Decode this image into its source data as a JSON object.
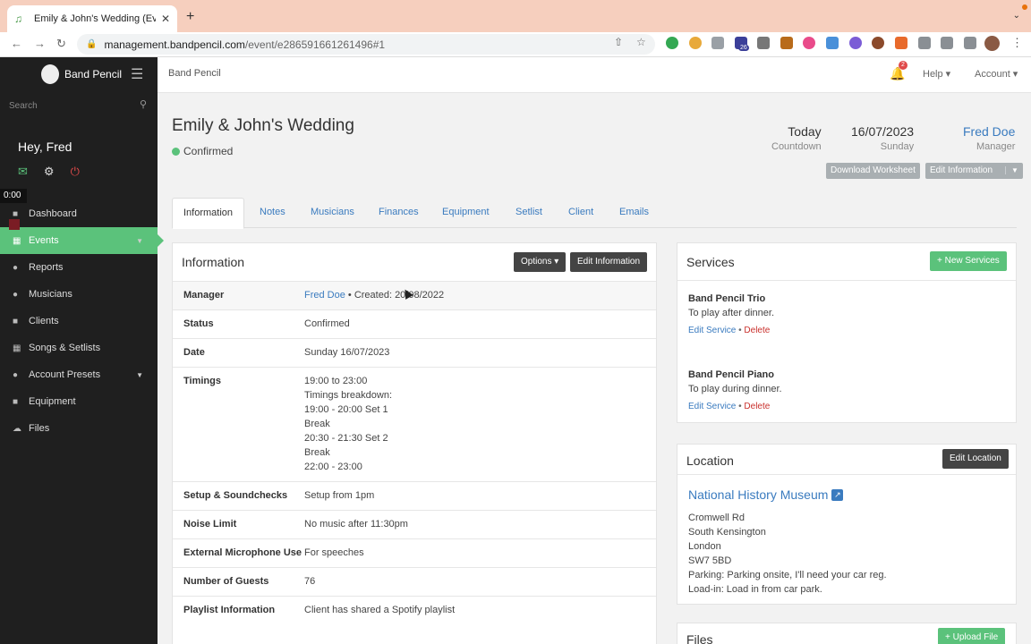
{
  "browser": {
    "tab_title": "Emily & John's Wedding (Event",
    "url_host": "management.bandpencil.com",
    "url_path": "/event/e286591661261496#1",
    "ext_badge": "26"
  },
  "sidebar": {
    "brand": "Band Pencil",
    "search_placeholder": "Search",
    "greeting": "Hey, Fred",
    "timer": "0:00",
    "items": [
      {
        "label": "Dashboard",
        "icon": "dashboard-icon"
      },
      {
        "label": "Events",
        "icon": "calendar-icon",
        "active": true
      },
      {
        "label": "Reports",
        "icon": "chart-icon"
      },
      {
        "label": "Musicians",
        "icon": "users-icon"
      },
      {
        "label": "Clients",
        "icon": "clients-icon"
      },
      {
        "label": "Songs & Setlists",
        "icon": "music-icon"
      },
      {
        "label": "Account Presets",
        "icon": "presets-icon"
      },
      {
        "label": "Equipment",
        "icon": "equipment-icon"
      },
      {
        "label": "Files",
        "icon": "cloud-icon"
      }
    ]
  },
  "header": {
    "breadcrumb": "Band Pencil",
    "notif_count": "2",
    "help": "Help",
    "account": "Account"
  },
  "event": {
    "title": "Emily & John's Wedding",
    "status": "Confirmed",
    "countdown_value": "Today",
    "countdown_label": "Countdown",
    "date_value": "16/07/2023",
    "date_label": "Sunday",
    "manager_value": "Fred Doe",
    "manager_label": "Manager",
    "download_btn": "Download Worksheet",
    "edit_btn": "Edit Information"
  },
  "tabs": [
    "Information",
    "Notes",
    "Musicians",
    "Finances",
    "Equipment",
    "Setlist",
    "Client",
    "Emails"
  ],
  "info": {
    "title": "Information",
    "options_btn": "Options",
    "edit_btn": "Edit Information",
    "manager_key": "Manager",
    "manager_name": "Fred Doe",
    "manager_created": " • Created: 20/08/2022",
    "status_key": "Status",
    "status_val": "Confirmed",
    "date_key": "Date",
    "date_val": "Sunday 16/07/2023",
    "timings_key": "Timings",
    "timings_lines": [
      "19:00 to 23:00",
      "Timings breakdown:",
      "19:00 - 20:00 Set 1",
      "Break",
      "20:30 - 21:30 Set 2",
      "Break",
      "22:00 - 23:00"
    ],
    "setup_key": "Setup & Soundchecks",
    "setup_val": "Setup from 1pm",
    "noise_key": "Noise Limit",
    "noise_val": "No music after 11:30pm",
    "mic_key": "External Microphone Use",
    "mic_val": "For speeches",
    "guests_key": "Number of Guests",
    "guests_val": "76",
    "playlist_key": "Playlist Information",
    "playlist_val": "Client has shared a Spotify playlist"
  },
  "services": {
    "title": "Services",
    "new_btn": "New Services",
    "edit_link": "Edit Service",
    "sep": " • ",
    "delete_link": "Delete",
    "items": [
      {
        "name": "Band Pencil Trio",
        "desc": "To play after dinner."
      },
      {
        "name": "Band Pencil Piano",
        "desc": "To play during dinner."
      }
    ]
  },
  "location": {
    "title": "Location",
    "edit_btn": "Edit Location",
    "name": "National History Museum",
    "lines": [
      "Cromwell Rd",
      "South Kensington",
      "London",
      "SW7 5BD",
      "Parking: Parking onsite, I'll need your car reg.",
      "Load-in: Load in from car park."
    ]
  },
  "files": {
    "title": "Files",
    "upload_btn": "Upload File"
  },
  "colors": {
    "accent_green": "#5bc27b",
    "link_blue": "#3a7bbf",
    "sidebar_bg": "#1f1f1f",
    "danger_red": "#c9302c"
  }
}
